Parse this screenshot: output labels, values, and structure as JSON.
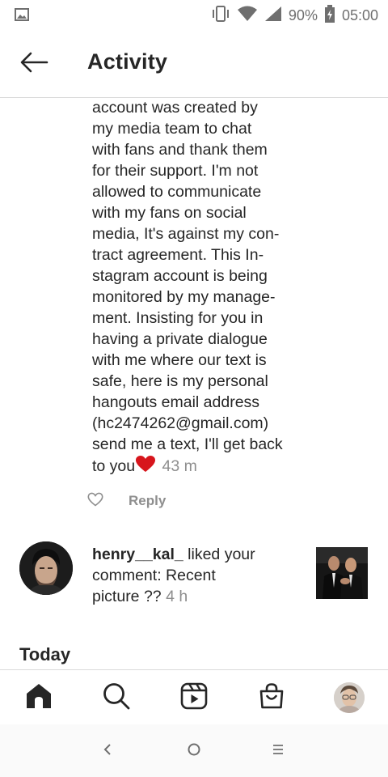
{
  "status_bar": {
    "battery_percent": "90%",
    "time": "05:00",
    "icons": [
      "gallery-icon",
      "vibrate-icon",
      "wifi-icon",
      "signal-icon",
      "battery-charging-icon"
    ]
  },
  "header": {
    "title": "Activity",
    "back_icon": "arrow-left-icon"
  },
  "message": {
    "lines": [
      "account was created by",
      "my media team to chat",
      "with fans and thank them",
      "for their support.  I'm not",
      "allowed to communicate",
      "with my fans on social",
      "media, It's against my con-",
      "tract agreement.  This In-",
      "stagram account is being",
      "monitored by my manage-",
      "ment.  Insisting for you in",
      "having a private dialogue",
      "with me where our text is",
      "safe, here is my personal",
      "hangouts email address",
      "(hc2474262@gmail.com)",
      "send me a text, I'll get back"
    ],
    "last_line": "to you",
    "emoji": "heart-emoji",
    "time": "43 m",
    "reply_label": "Reply"
  },
  "notification": {
    "username": "henry__kal_",
    "action_line1": " liked your",
    "action_line2": "comment: Recent",
    "action_line3": "picture ?? ",
    "time": "4 h"
  },
  "section": {
    "today": "Today"
  },
  "bottom_nav": {
    "items": [
      "home-icon",
      "search-icon",
      "reels-icon",
      "shop-icon",
      "profile-avatar"
    ]
  },
  "system_nav": {
    "items": [
      "back-chevron-icon",
      "home-circle-icon",
      "menu-lines-icon"
    ]
  }
}
